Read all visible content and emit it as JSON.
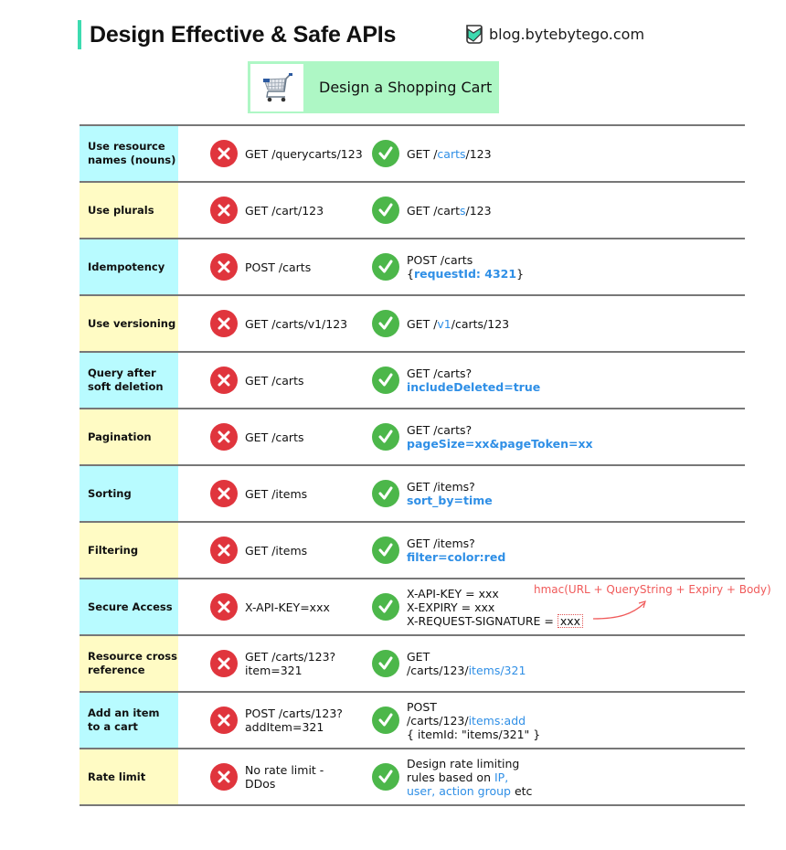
{
  "header": {
    "title": "Design Effective & Safe APIs",
    "brand": "blog.bytebytego.com",
    "accent_color": "#3ddbb0"
  },
  "banner": {
    "icon": "shopping-cart-icon",
    "label": "Design a Shopping Cart",
    "background": "#aef7c5"
  },
  "colors": {
    "cyan_row": "#b8fbff",
    "yellow_row": "#fffbc4",
    "bad_icon": "#e0353d",
    "good_icon": "#4cb74a",
    "highlight": "#2f8fe6",
    "annotation": "#f05a5a"
  },
  "rows": [
    {
      "label_1": "Use resource",
      "label_2": "names (nouns)",
      "bad_1": "GET /querycarts/123",
      "good_a": "GET /",
      "good_hl": "carts",
      "good_b": "/123"
    },
    {
      "label_1": "Use plurals",
      "bad_1": "GET /cart/123",
      "good_a": "GET /cart",
      "good_hl": "s",
      "good_b": "/123"
    },
    {
      "label_1": "Idempotency",
      "bad_1": "POST /carts",
      "good_1": "POST /carts",
      "good_2a": "{",
      "good_2hl": "requestId: 4321",
      "good_2b": "}"
    },
    {
      "label_1": "Use versioning",
      "bad_1": "GET /carts/v1/123",
      "good_a": "GET /",
      "good_hl": "v1",
      "good_b": "/carts/123"
    },
    {
      "label_1": "Query after",
      "label_2": "soft deletion",
      "bad_1": "GET /carts",
      "good_1": "GET /carts?",
      "good_2hl": "includeDeleted=true"
    },
    {
      "label_1": "Pagination",
      "bad_1": "GET /carts",
      "good_1": "GET /carts?",
      "good_2hl": "pageSize=xx&pageToken=xx"
    },
    {
      "label_1": "Sorting",
      "bad_1": "GET /items",
      "good_1": "GET /items?",
      "good_2hl": "sort_by=time"
    },
    {
      "label_1": "Filtering",
      "bad_1": "GET /items",
      "good_1": "GET /items?",
      "good_2hl": "filter=color:red"
    },
    {
      "label_1": "Secure Access",
      "bad_1": "X-API-KEY=xxx",
      "good_1": "X-API-KEY = xxx",
      "good_2": "X-EXPIRY = xxx",
      "good_3a": "X-REQUEST-SIGNATURE = ",
      "good_3box": "xxx",
      "annotation": "hmac(URL + QueryString + Expiry + Body)"
    },
    {
      "label_1": "Resource cross",
      "label_2": "reference",
      "bad_1": "GET /carts/123?",
      "bad_2": "item=321",
      "good_1": "GET",
      "good_2a": "/carts/123/",
      "good_2hl": "items/321"
    },
    {
      "label_1": "Add an item",
      "label_2": "to a cart",
      "bad_1": "POST /carts/123?",
      "bad_2": "addItem=321",
      "good_1": "POST",
      "good_2a": "/carts/123/",
      "good_2hl": "items:add",
      "good_3": "{ itemId: \"items/321\" }"
    },
    {
      "label_1": "Rate limit",
      "bad_1": "No rate limit -",
      "bad_2": "DDos",
      "good_1": "Design rate limiting",
      "good_2a": "rules based on ",
      "good_2hl": "IP,",
      "good_3hl": "user, action group",
      "good_3b": " etc"
    }
  ]
}
